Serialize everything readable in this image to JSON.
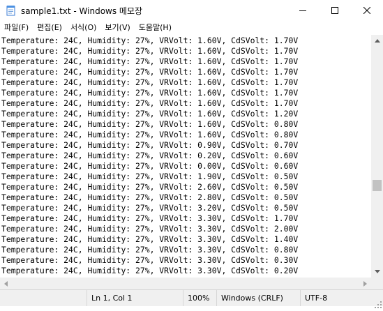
{
  "window": {
    "title": "sample1.txt - Windows 메모장"
  },
  "menu": [
    {
      "label": "파일(F)"
    },
    {
      "label": "편집(E)"
    },
    {
      "label": "서식(O)"
    },
    {
      "label": "보기(V)"
    },
    {
      "label": "도움말(H)"
    }
  ],
  "editor": {
    "lines": [
      "Temperature: 24C, Humidity: 27%, VRVolt: 1.60V, CdSVolt: 1.70V",
      "Temperature: 24C, Humidity: 27%, VRVolt: 1.60V, CdSVolt: 1.70V",
      "Temperature: 24C, Humidity: 27%, VRVolt: 1.60V, CdSVolt: 1.70V",
      "Temperature: 24C, Humidity: 27%, VRVolt: 1.60V, CdSVolt: 1.70V",
      "Temperature: 24C, Humidity: 27%, VRVolt: 1.60V, CdSVolt: 1.70V",
      "Temperature: 24C, Humidity: 27%, VRVolt: 1.60V, CdSVolt: 1.70V",
      "Temperature: 24C, Humidity: 27%, VRVolt: 1.60V, CdSVolt: 1.70V",
      "Temperature: 24C, Humidity: 27%, VRVolt: 1.60V, CdSVolt: 1.20V",
      "Temperature: 24C, Humidity: 27%, VRVolt: 1.60V, CdSVolt: 0.80V",
      "Temperature: 24C, Humidity: 27%, VRVolt: 1.60V, CdSVolt: 0.80V",
      "Temperature: 24C, Humidity: 27%, VRVolt: 0.90V, CdSVolt: 0.70V",
      "Temperature: 24C, Humidity: 27%, VRVolt: 0.20V, CdSVolt: 0.60V",
      "Temperature: 24C, Humidity: 27%, VRVolt: 0.00V, CdSVolt: 0.60V",
      "Temperature: 24C, Humidity: 27%, VRVolt: 1.90V, CdSVolt: 0.50V",
      "Temperature: 24C, Humidity: 27%, VRVolt: 2.60V, CdSVolt: 0.50V",
      "Temperature: 24C, Humidity: 27%, VRVolt: 2.80V, CdSVolt: 0.50V",
      "Temperature: 24C, Humidity: 27%, VRVolt: 3.20V, CdSVolt: 0.50V",
      "Temperature: 24C, Humidity: 27%, VRVolt: 3.30V, CdSVolt: 1.70V",
      "Temperature: 24C, Humidity: 27%, VRVolt: 3.30V, CdSVolt: 2.00V",
      "Temperature: 24C, Humidity: 27%, VRVolt: 3.30V, CdSVolt: 1.40V",
      "Temperature: 24C, Humidity: 27%, VRVolt: 3.30V, CdSVolt: 0.80V",
      "Temperature: 24C, Humidity: 27%, VRVolt: 3.30V, CdSVolt: 0.30V",
      "Temperature: 24C, Humidity: 27%, VRVolt: 3.30V, CdSVolt: 0.20V"
    ]
  },
  "status": {
    "position": "Ln 1, Col 1",
    "zoom": "100%",
    "line_ending": "Windows (CRLF)",
    "encoding": "UTF-8"
  }
}
